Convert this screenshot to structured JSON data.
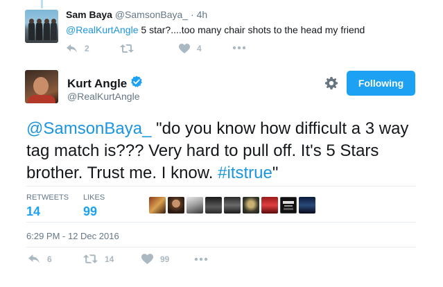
{
  "reply_tweet": {
    "name": "Sam Baya",
    "handle": "@SamsonBaya_",
    "separator": "·",
    "time": "4h",
    "mention": "@RealKurtAngle",
    "text": " 5 star?....too many chair shots to the head my friend",
    "actions": {
      "reply_count": "2",
      "retweet_count": "",
      "like_count": "4"
    }
  },
  "main_tweet": {
    "name": "Kurt Angle",
    "handle": "@RealKurtAngle",
    "follow_label": "Following",
    "text_mention": "@SamsonBaya_",
    "text_body": " \"do you know how difficult a 3 way tag match is??? Very hard to pull off. It's 5 Stars brother. Trust me. I know. ",
    "text_hashtag": "#itstrue",
    "text_end": "\"",
    "stats": {
      "retweets_label": "RETWEETS",
      "retweets_value": "14",
      "likes_label": "LIKES",
      "likes_value": "99"
    },
    "timestamp": "6:29 PM - 12 Dec 2016",
    "actions": {
      "reply_count": "6",
      "retweet_count": "14",
      "like_count": "99"
    }
  },
  "colors": {
    "accent": "#1da1f2",
    "link": "#1b95e0",
    "muted": "#657786",
    "icon": "#aab8c2"
  },
  "icons": {
    "reply": "reply-icon",
    "retweet": "retweet-icon",
    "like": "heart-icon",
    "more": "more-icon",
    "gear": "gear-icon",
    "verified": "verified-badge-icon"
  }
}
